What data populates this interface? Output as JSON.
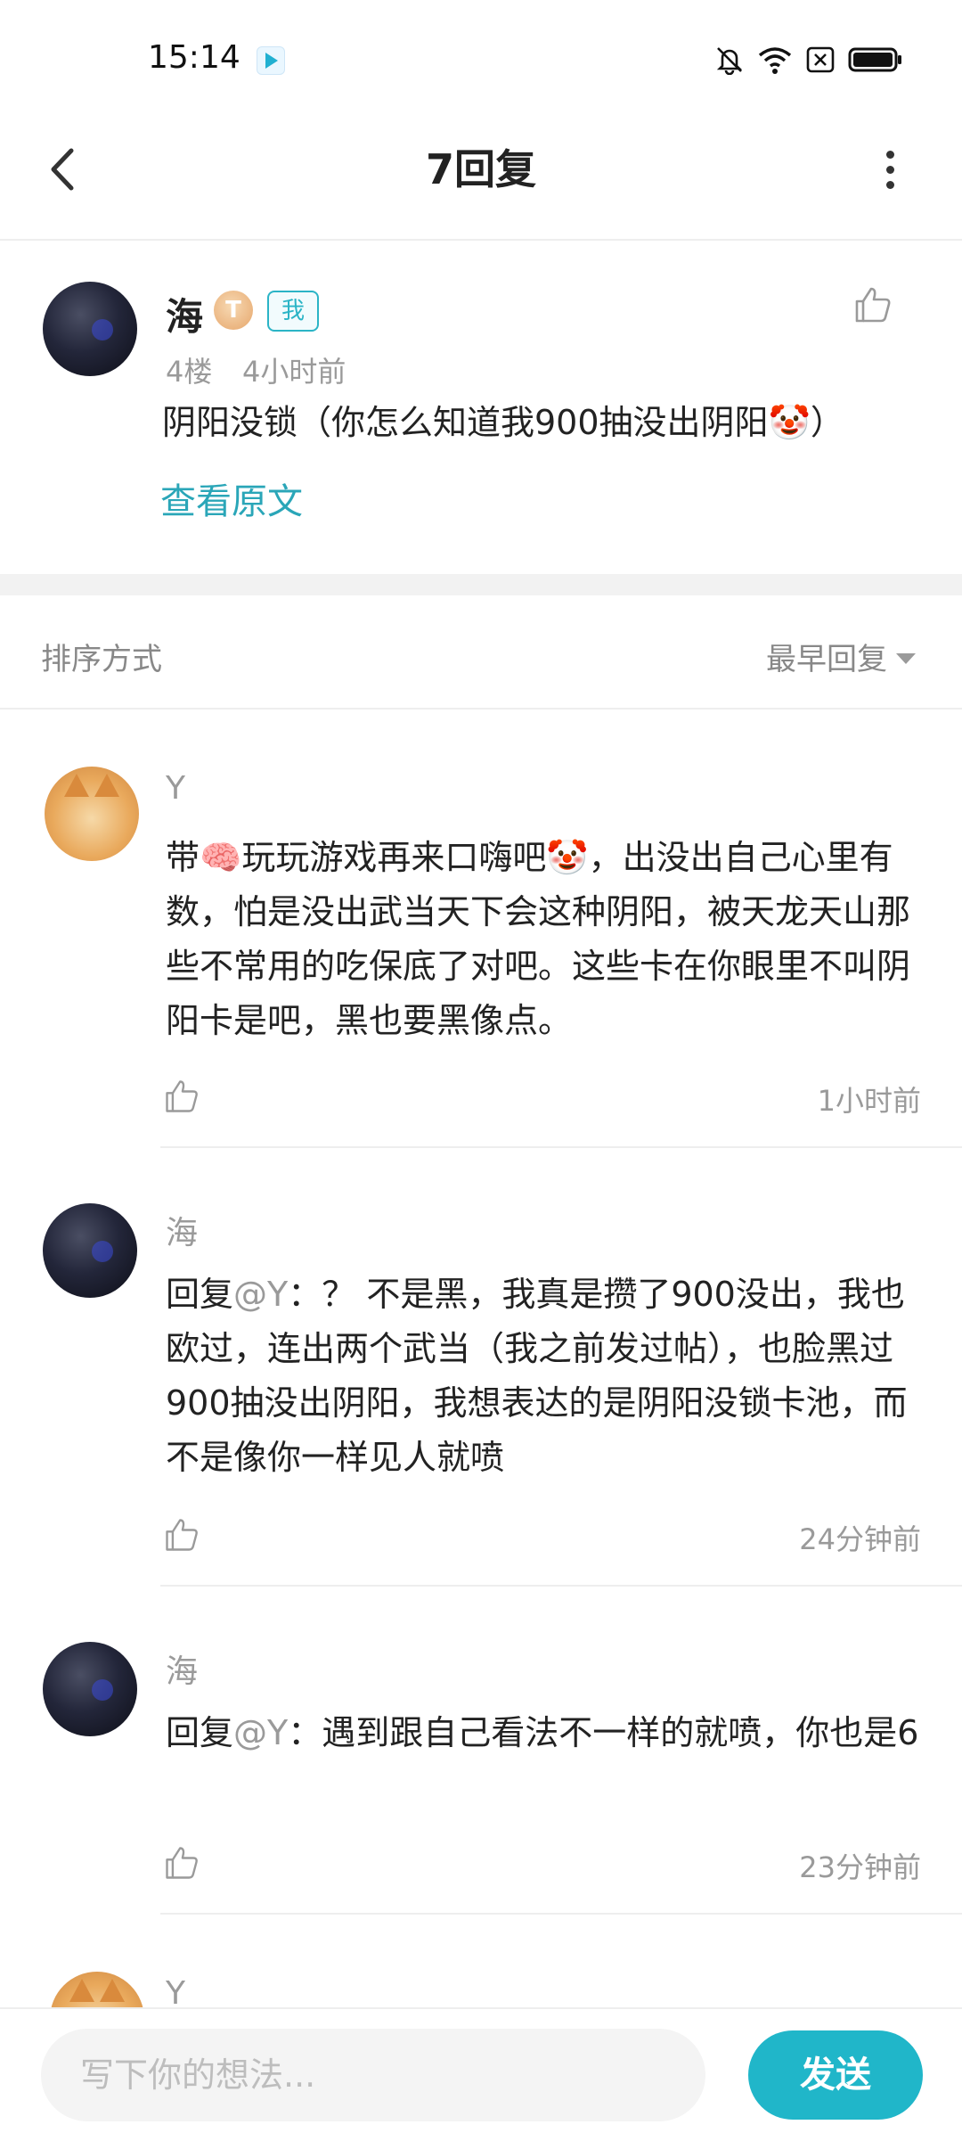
{
  "status_bar": {
    "time": "15:14",
    "icons": [
      "app-notification-icon",
      "bell-off-icon",
      "wifi-icon",
      "sim-off-icon",
      "battery-icon"
    ]
  },
  "header": {
    "title": "7回复",
    "back_icon": "chevron-left-icon",
    "more_icon": "more-vertical-icon"
  },
  "original_comment": {
    "author": "海",
    "level_badge": "T",
    "me_badge": "我",
    "floor": "4楼",
    "time": "4小时前",
    "text": "阴阳没锁（你怎么知道我900抽没出阴阳🤡）",
    "view_original": "查看原文"
  },
  "sort": {
    "label": "排序方式",
    "selected": "最早回复"
  },
  "replies": [
    {
      "author": "Y",
      "avatar": "shiba-avatar",
      "text": "带🧠玩玩游戏再来口嗨吧🤡，出没出自己心里有数，怕是没出武当天下会这种阴阳，被天龙天山那些不常用的吃保底了对吧。这些卡在你眼里不叫阴阳卡是吧，黑也要黑像点。",
      "time": "1小时前"
    },
    {
      "author": "海",
      "avatar": "dark-avatar",
      "reply_prefix": "回复",
      "mention": "@Y",
      "text": "：？ 不是黑，我真是攒了900没出，我也欧过，连出两个武当（我之前发过帖），也脸黑过900抽没出阴阳，我想表达的是阴阳没锁卡池，而不是像你一样见人就喷",
      "time": "24分钟前"
    },
    {
      "author": "海",
      "avatar": "dark-avatar",
      "reply_prefix": "回复",
      "mention": "@Y",
      "text": "：遇到跟自己看法不一样的就喷，你也是6",
      "time": "23分钟前"
    },
    {
      "author": "Y",
      "avatar": "shiba-avatar"
    }
  ],
  "composer": {
    "placeholder": "写下你的想法...",
    "send_label": "发送"
  },
  "colors": {
    "accent": "#20b6c9",
    "link": "#2aa6b8",
    "muted": "#9a9a9a"
  }
}
